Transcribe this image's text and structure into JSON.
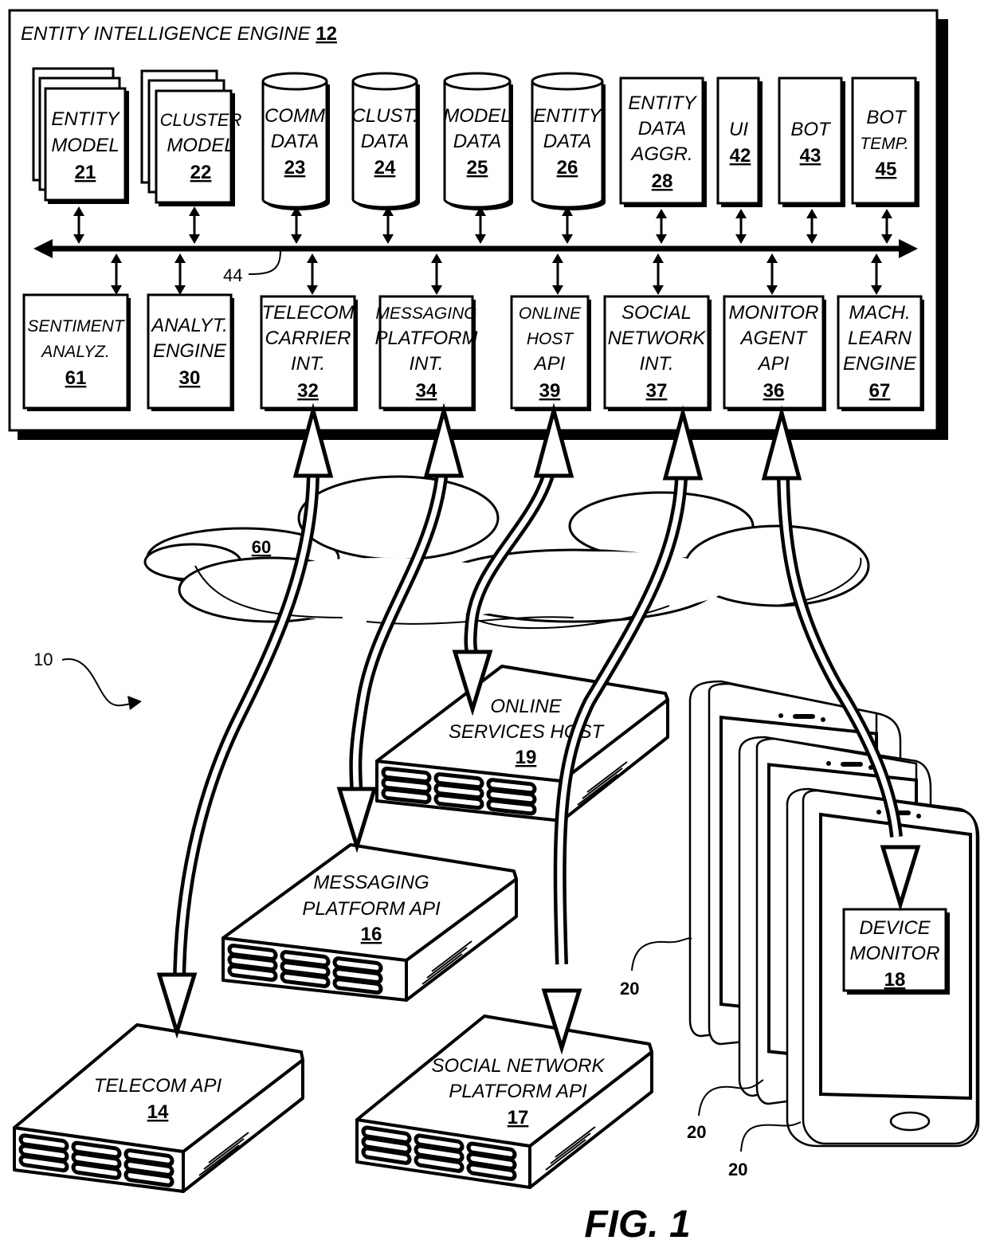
{
  "figure": {
    "label": "FIG. 1",
    "system_ref": "10",
    "network_ref": "60",
    "bus_ref": "44"
  },
  "engine": {
    "title": "ENTITY INTELLIGENCE ENGINE",
    "ref": "12",
    "top_components": [
      {
        "id": "entity-model",
        "shape": "stacked-doc",
        "lines": [
          "ENTITY",
          "MODEL"
        ],
        "ref": "21"
      },
      {
        "id": "cluster-model",
        "shape": "stacked-doc",
        "lines": [
          "CLUSTER",
          "MODEL"
        ],
        "ref": "22"
      },
      {
        "id": "comm-data",
        "shape": "cylinder",
        "lines": [
          "COMM",
          "DATA"
        ],
        "ref": "23"
      },
      {
        "id": "clust-data",
        "shape": "cylinder",
        "lines": [
          "CLUST.",
          "DATA"
        ],
        "ref": "24"
      },
      {
        "id": "model-data",
        "shape": "cylinder",
        "lines": [
          "MODEL",
          "DATA"
        ],
        "ref": "25"
      },
      {
        "id": "entity-data",
        "shape": "cylinder",
        "lines": [
          "ENTITY",
          "DATA"
        ],
        "ref": "26"
      },
      {
        "id": "entity-data-aggr",
        "shape": "box",
        "lines": [
          "ENTITY",
          "DATA",
          "AGGR."
        ],
        "ref": "28"
      },
      {
        "id": "ui",
        "shape": "box",
        "lines": [
          "UI"
        ],
        "ref": "42"
      },
      {
        "id": "bot",
        "shape": "box",
        "lines": [
          "BOT"
        ],
        "ref": "43"
      },
      {
        "id": "bot-temp",
        "shape": "box",
        "lines": [
          "BOT",
          "TEMP."
        ],
        "ref": "45"
      }
    ],
    "bottom_components": [
      {
        "id": "sentiment-analyz",
        "lines": [
          "SENTIMENT",
          "ANALYZ."
        ],
        "ref": "61"
      },
      {
        "id": "analyt-engine",
        "lines": [
          "ANALYT.",
          "ENGINE"
        ],
        "ref": "30"
      },
      {
        "id": "telecom-carrier-int",
        "lines": [
          "TELECOM",
          "CARRIER",
          "INT."
        ],
        "ref": "32"
      },
      {
        "id": "messaging-platform-int",
        "lines": [
          "MESSAGING",
          "PLATFORM",
          "INT."
        ],
        "ref": "34"
      },
      {
        "id": "online-host-api",
        "lines": [
          "ONLINE",
          "HOST",
          "API"
        ],
        "ref": "39"
      },
      {
        "id": "social-network-int",
        "lines": [
          "SOCIAL",
          "NETWORK",
          "INT."
        ],
        "ref": "37"
      },
      {
        "id": "monitor-agent-api",
        "lines": [
          "MONITOR",
          "AGENT",
          "API"
        ],
        "ref": "36"
      },
      {
        "id": "mach-learn-engine",
        "lines": [
          "MACH.",
          "LEARN",
          "ENGINE"
        ],
        "ref": "67"
      }
    ]
  },
  "servers": [
    {
      "id": "online-services-host",
      "lines": [
        "ONLINE",
        "SERVICES HOST"
      ],
      "ref": "19"
    },
    {
      "id": "messaging-platform-api",
      "lines": [
        "MESSAGING",
        "PLATFORM API"
      ],
      "ref": "16"
    },
    {
      "id": "telecom-api",
      "lines": [
        "TELECOM API"
      ],
      "ref": "14"
    },
    {
      "id": "social-network-platform-api",
      "lines": [
        "SOCIAL NETWORK",
        "PLATFORM API"
      ],
      "ref": "17"
    }
  ],
  "devices": {
    "ref": "20",
    "monitor": {
      "lines": [
        "DEVICE",
        "MONITOR"
      ],
      "ref": "18"
    }
  },
  "links": [
    {
      "from": "telecom-carrier-int",
      "to": "telecom-api"
    },
    {
      "from": "messaging-platform-int",
      "to": "messaging-platform-api"
    },
    {
      "from": "online-host-api",
      "to": "online-services-host"
    },
    {
      "from": "social-network-int",
      "to": "social-network-platform-api"
    },
    {
      "from": "monitor-agent-api",
      "to": "device-monitor"
    }
  ]
}
